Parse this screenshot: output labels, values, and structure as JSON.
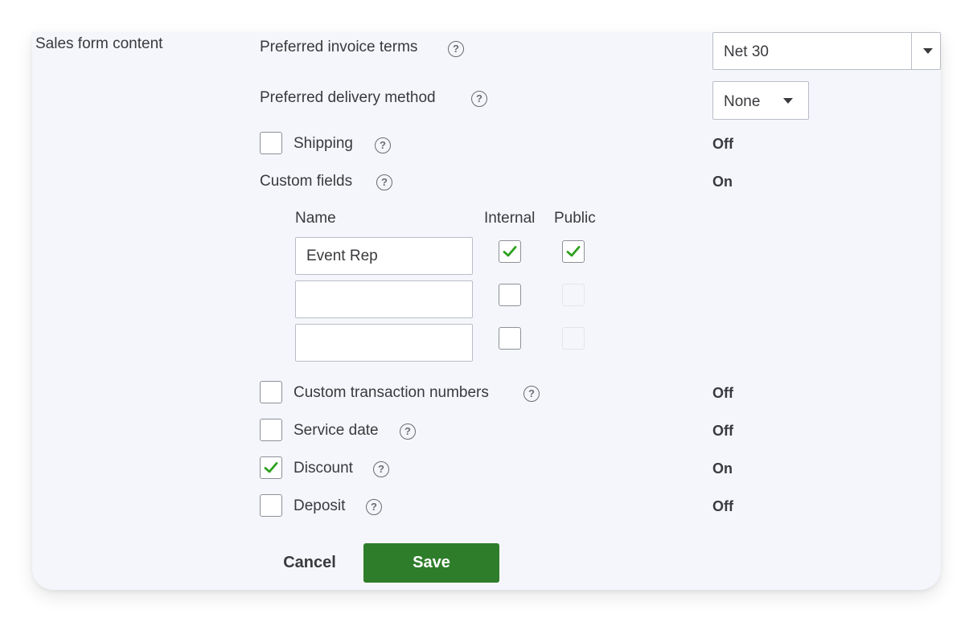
{
  "section": {
    "title": "Sales form content"
  },
  "invoice_terms": {
    "label": "Preferred invoice terms",
    "value": "Net 30"
  },
  "delivery_method": {
    "label": "Preferred delivery method",
    "value": "None"
  },
  "shipping": {
    "label": "Shipping",
    "status": "Off",
    "checked": false
  },
  "custom_fields": {
    "label": "Custom fields",
    "status": "On",
    "columns": {
      "name": "Name",
      "internal": "Internal",
      "public": "Public"
    },
    "rows": [
      {
        "name": "Event Rep",
        "internal": true,
        "public": true
      },
      {
        "name": "",
        "internal": false,
        "public": false
      },
      {
        "name": "",
        "internal": false,
        "public": false
      }
    ]
  },
  "custom_transaction_numbers": {
    "label": "Custom transaction numbers",
    "status": "Off",
    "checked": false
  },
  "service_date": {
    "label": "Service date",
    "status": "Off",
    "checked": false
  },
  "discount": {
    "label": "Discount",
    "status": "On",
    "checked": true
  },
  "deposit": {
    "label": "Deposit",
    "status": "Off",
    "checked": false
  },
  "help_glyph": "?",
  "buttons": {
    "cancel": "Cancel",
    "save": "Save"
  },
  "colors": {
    "accent_green": "#2e7d2a",
    "check_green": "#2ca01c",
    "panel_bg": "#f4f6fb"
  }
}
